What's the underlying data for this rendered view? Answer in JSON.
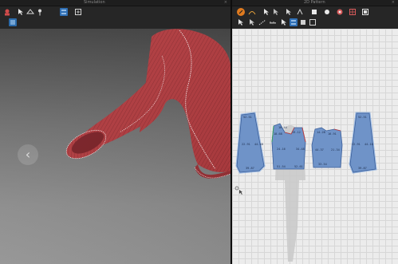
{
  "panes": {
    "left_title": "Simulation",
    "right_title": "2D Pattern",
    "close_glyph": "×"
  },
  "viewport3d": {
    "nav_glyph": "‹"
  },
  "toolbar_left": {
    "row1": [
      "avatar-tool",
      "select-arrow-tool",
      "fold-tool",
      "pin-tool",
      "sewing-tool",
      "fabric-tool"
    ],
    "row2": [
      "fit-view-tool"
    ]
  },
  "toolbar_right": {
    "row1": [
      "transform-tool",
      "select-point-tool",
      "edit-curve-tool",
      "add-point-tool",
      "segment-tool",
      "rectangle-tool",
      "circle-tool",
      "polygon-tool",
      "internal-shape-tool",
      "grid-tool",
      "square-tool"
    ],
    "row2": [
      "edit-pattern-tool",
      "edit-sewing-tool",
      "seam-tool",
      "measure-tool",
      "notch-tool",
      "trace-tool",
      "layout-tool",
      "snap-tool",
      "grade-tool"
    ]
  },
  "pattern_pieces": [
    {
      "id": "left-sleeve",
      "labels": [
        "52.51",
        "22.91",
        "44.18",
        "39.87",
        "34.16"
      ]
    },
    {
      "id": "front-bodice",
      "labels": [
        "16.44",
        "18.68",
        "19.12",
        "24.16",
        "34.48",
        "41.30",
        "18.72",
        "51.54",
        "52.61"
      ]
    },
    {
      "id": "back-bodice",
      "labels": [
        "14.28",
        "16.91",
        "44.37",
        "21.34",
        "24.51",
        "33.54"
      ]
    },
    {
      "id": "right-sleeve",
      "labels": [
        "52.51",
        "22.91",
        "44.18",
        "39.87",
        "33.78"
      ]
    }
  ],
  "colors": {
    "accent_orange": "#e07b1f",
    "blue_icon": "#3f8fd8",
    "garment_red": "#b23a3e",
    "pattern_blue": "#6f93c8"
  }
}
